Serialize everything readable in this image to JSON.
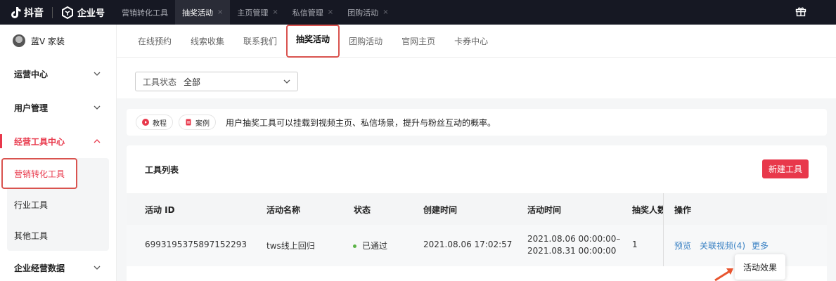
{
  "topbar": {
    "app_name": "抖音",
    "enterprise": "企业号",
    "tabs": [
      {
        "label": "营销转化工具",
        "active": false,
        "closable": false
      },
      {
        "label": "抽奖活动",
        "active": true,
        "closable": true
      },
      {
        "label": "主页管理",
        "active": false,
        "closable": true
      },
      {
        "label": "私信管理",
        "active": false,
        "closable": true
      },
      {
        "label": "团购活动",
        "active": false,
        "closable": true
      }
    ],
    "close_glyph": "×",
    "gift_icon": "gift-icon"
  },
  "sidebar": {
    "user_name": "蓝V 家装",
    "items": [
      {
        "label": "运营中心",
        "expanded": false
      },
      {
        "label": "用户管理",
        "expanded": false
      },
      {
        "label": "经营工具中心",
        "expanded": true
      },
      {
        "label": "企业经营数据",
        "expanded": false
      }
    ],
    "subitems": [
      {
        "label": "营销转化工具",
        "active": true
      },
      {
        "label": "行业工具",
        "active": false
      },
      {
        "label": "其他工具",
        "active": false
      }
    ]
  },
  "subnav": {
    "items": [
      {
        "label": "在线预约",
        "active": false
      },
      {
        "label": "线索收集",
        "active": false
      },
      {
        "label": "联系我们",
        "active": false
      },
      {
        "label": "抽奖活动",
        "active": true
      },
      {
        "label": "团购活动",
        "active": false
      },
      {
        "label": "官网主页",
        "active": false
      },
      {
        "label": "卡券中心",
        "active": false
      }
    ]
  },
  "filter": {
    "label": "工具状态",
    "value": "全部"
  },
  "info": {
    "tutorial_label": "教程",
    "case_label": "案例",
    "text": "用户抽奖工具可以挂载到视频主页、私信场景，提升与粉丝互动的概率。"
  },
  "tool_list": {
    "title": "工具列表",
    "new_button": "新建工具",
    "columns": [
      "活动 ID",
      "活动名称",
      "状态",
      "创建时间",
      "活动时间",
      "抽奖人数",
      "操作"
    ],
    "rows": [
      {
        "id": "6993195375897152293",
        "name": "tws线上回归",
        "status": "已通过",
        "created": "2021.08.06 17:02:57",
        "time_start": "2021.08.06 00:00:00–",
        "time_end": "2021.08.31 00:00:00",
        "count": "1",
        "actions": {
          "preview": "预览",
          "link_video": "关联视频(4)",
          "more": "更多"
        }
      }
    ],
    "popover_item": "活动效果"
  },
  "colors": {
    "accent": "#e8384b",
    "link": "#3b82c4",
    "status_ok": "#5bb346",
    "topbar_bg": "#161823",
    "highlight_box": "#d9534f"
  }
}
